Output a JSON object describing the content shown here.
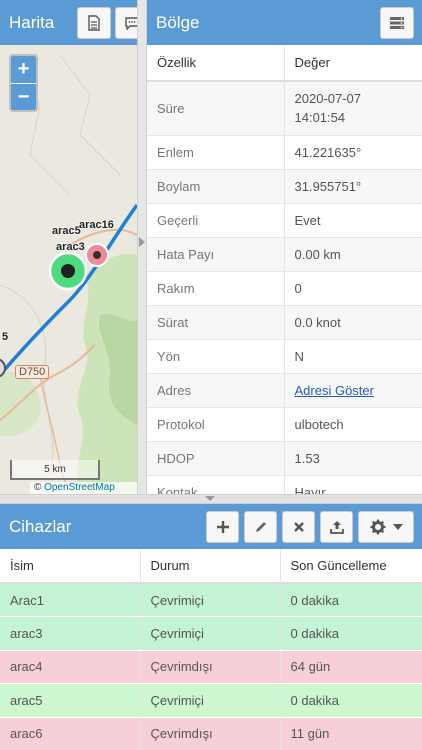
{
  "map": {
    "title": "Harita",
    "zoom_in": "+",
    "zoom_out": "−",
    "labels": [
      "arac5",
      "arac16",
      "arac3",
      "5"
    ],
    "road_label": "D750",
    "scale": "5 km",
    "attribution_symbol": "©",
    "attribution_link": "OpenStreetMap",
    "icons": [
      "document-icon",
      "chat-icon"
    ]
  },
  "region": {
    "title": "Bölge",
    "header_icon": "server-icon",
    "columns": [
      "Özellik",
      "Değer"
    ],
    "rows": [
      {
        "key": "Süre",
        "value": "2020-07-07 14:01:54"
      },
      {
        "key": "Enlem",
        "value": "41.221635°"
      },
      {
        "key": "Boylam",
        "value": "31.955751°"
      },
      {
        "key": "Geçerli",
        "value": "Evet"
      },
      {
        "key": "Hata Payı",
        "value": "0.00 km"
      },
      {
        "key": "Rakım",
        "value": "0"
      },
      {
        "key": "Sürat",
        "value": "0.0 knot"
      },
      {
        "key": "Yön",
        "value": "N"
      },
      {
        "key": "Adres",
        "value": "Adresi Göster"
      },
      {
        "key": "Protokol",
        "value": "ulbotech"
      },
      {
        "key": "HDOP",
        "value": "1.53"
      },
      {
        "key": "Kontak",
        "value": "Hayır"
      }
    ]
  },
  "devices": {
    "title": "Cihazlar",
    "toolbar_icons": [
      "add-icon",
      "edit-icon",
      "delete-icon",
      "upload-icon",
      "gear-icon"
    ],
    "columns": [
      "İsim",
      "Durum",
      "Son Güncelleme"
    ],
    "rows": [
      {
        "name": "Arac1",
        "status": "Çevrimiçi",
        "updated": "0 dakika"
      },
      {
        "name": "arac3",
        "status": "Çevrimiçi",
        "updated": "0 dakika"
      },
      {
        "name": "arac4",
        "status": "Çevrimdışı",
        "updated": "64 gün"
      },
      {
        "name": "arac5",
        "status": "Çevrimiçi",
        "updated": "0 dakika"
      },
      {
        "name": "arac6",
        "status": "Çevrimdışı",
        "updated": "11 gün"
      }
    ]
  },
  "colors": {
    "header": "#5b9bd5",
    "online_row": "#c5f3d5",
    "offline_row": "#f7cfd8",
    "route": "#1f7fd6",
    "marker_online": "#4ddb7d",
    "marker_offline": "#ef8a99"
  }
}
